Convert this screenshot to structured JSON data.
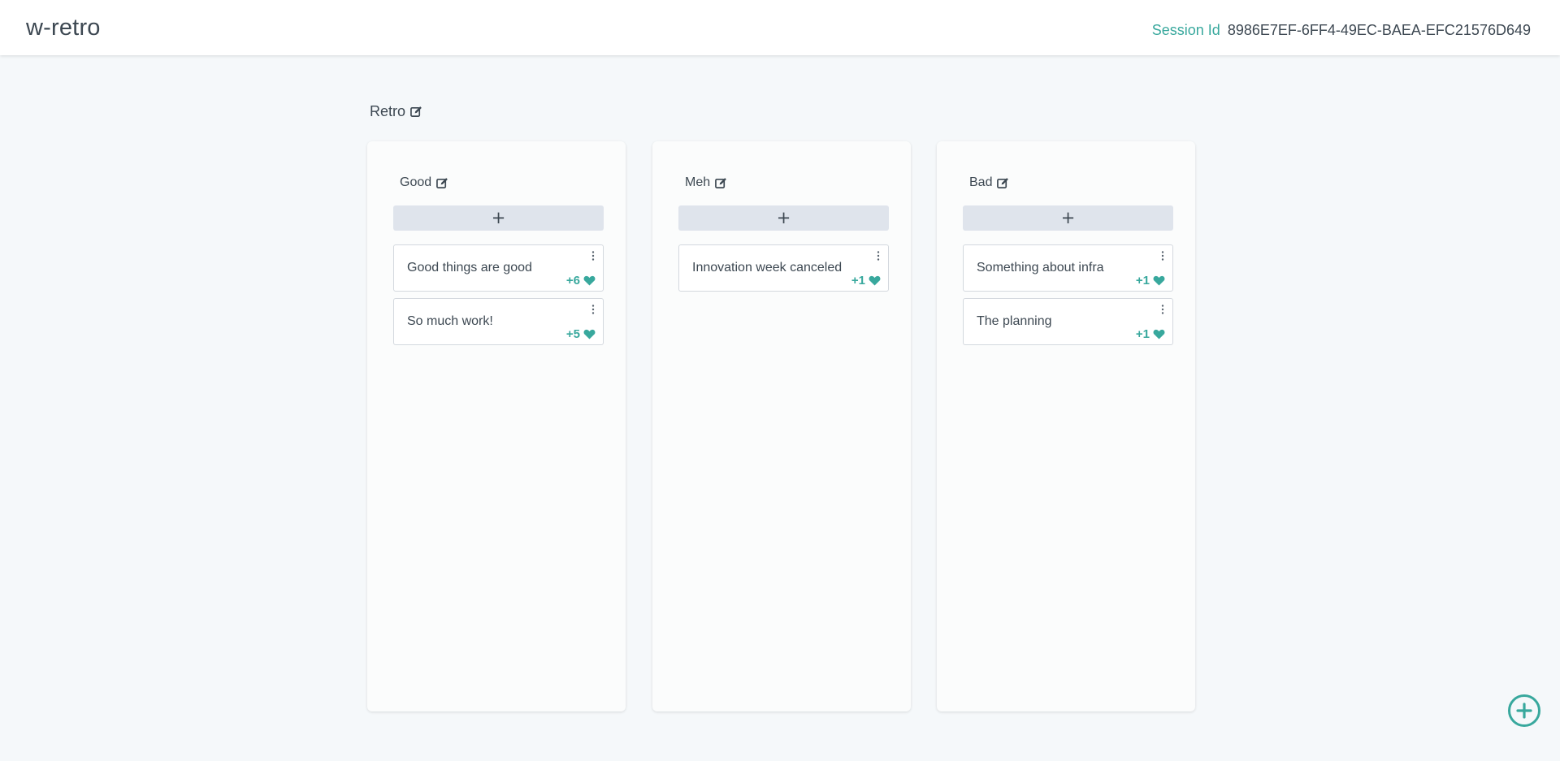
{
  "app": {
    "title": "w-retro"
  },
  "session": {
    "label": "Session Id",
    "id": "8986E7EF-6FF4-49EC-BAEA-EFC21576D649"
  },
  "board": {
    "title": "Retro"
  },
  "columns": [
    {
      "title": "Good",
      "add_label": "+",
      "cards": [
        {
          "text": "Good things are good",
          "votes": "+6"
        },
        {
          "text": "So much work!",
          "votes": "+5"
        }
      ]
    },
    {
      "title": "Meh",
      "add_label": "+",
      "cards": [
        {
          "text": "Innovation week canceled",
          "votes": "+1"
        }
      ]
    },
    {
      "title": "Bad",
      "add_label": "+",
      "cards": [
        {
          "text": "Something about infra",
          "votes": "+1"
        },
        {
          "text": "The planning",
          "votes": "+1"
        }
      ]
    }
  ],
  "icons": {
    "edit": "edit-icon",
    "menu": "more-vertical-icon",
    "vote": "heart-icon",
    "fab": "plus-circle-icon"
  },
  "colors": {
    "accent": "#38a89d",
    "text": "#3d4852",
    "background": "#f5f8fa"
  }
}
